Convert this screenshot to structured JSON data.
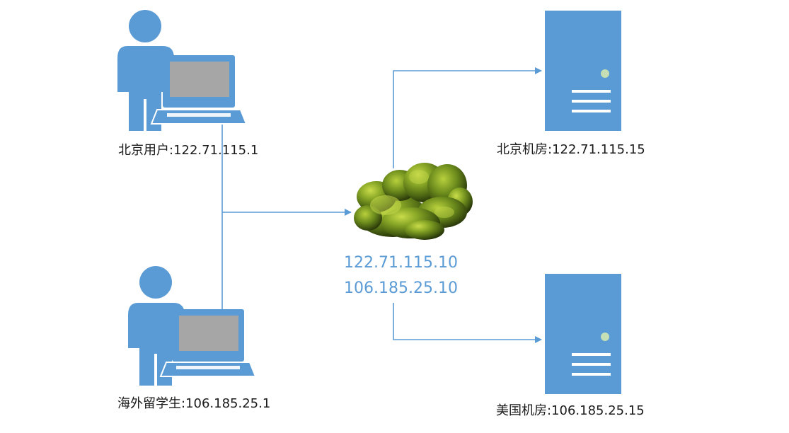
{
  "colors": {
    "icon_blue": "#5b9bd5",
    "screen_gray": "#a6a6a6",
    "line_blue": "#5b9bd5",
    "label_text": "#1a1a1a",
    "cloud_ip_text": "#5b9bd5",
    "led_green": "#c5e0b4"
  },
  "nodes": {
    "beijing_user": {
      "icon": "user-with-laptop-icon",
      "label": "北京用户:122.71.115.1"
    },
    "overseas_student": {
      "icon": "user-with-laptop-icon",
      "label": "海外留学生:106.185.25.1"
    },
    "cloud": {
      "icon": "cloud-bush-icon",
      "ip_1": "122.71.115.10",
      "ip_2": "106.185.25.10"
    },
    "beijing_server": {
      "icon": "server-tower-icon",
      "label": "北京机房:122.71.115.15"
    },
    "us_server": {
      "icon": "server-tower-icon",
      "label": "美国机房:106.185.25.15"
    }
  }
}
